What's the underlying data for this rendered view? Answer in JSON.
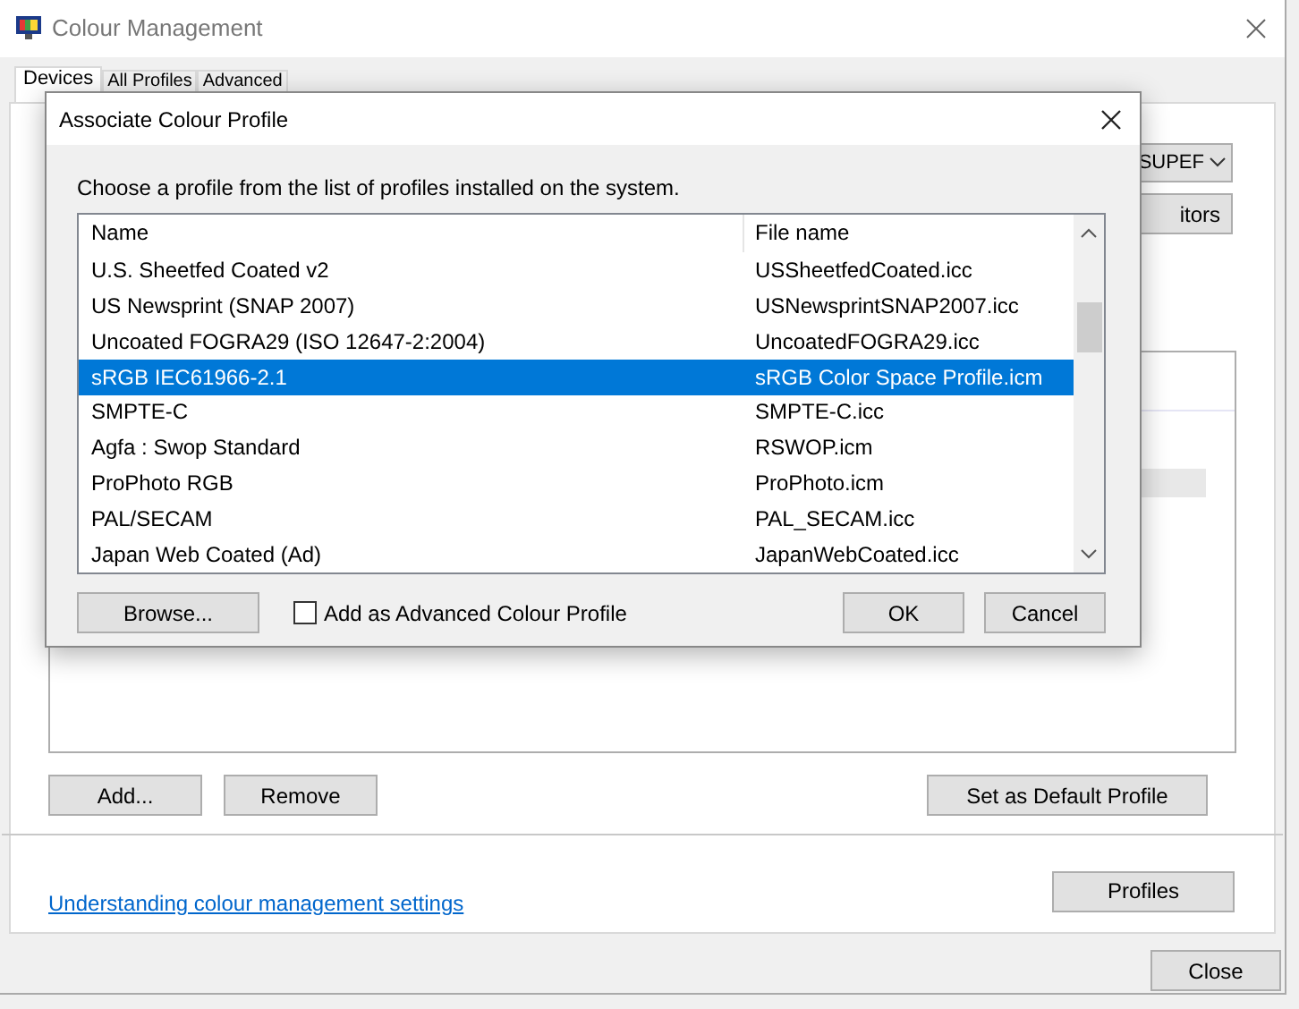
{
  "window": {
    "title": "Colour Management"
  },
  "tabs": [
    {
      "label": "Devices",
      "selected": true
    },
    {
      "label": "All Profiles",
      "selected": false
    },
    {
      "label": "Advanced",
      "selected": false
    }
  ],
  "device_dropdown": {
    "value": "SUPEF"
  },
  "monitors_button": "itors",
  "profile_buttons": [
    "Add...",
    "Remove"
  ],
  "default_button": "Set as Default Profile",
  "help_link": "Understanding colour management settings",
  "profiles_button": "Profiles",
  "close_button": "Close",
  "dialog": {
    "title": "Associate Colour Profile",
    "instruction": "Choose a profile from the list of profiles installed on the system.",
    "columns": [
      "Name",
      "File name"
    ],
    "rows": [
      {
        "name": "U.S. Sheetfed Coated v2",
        "file": "USSheetfedCoated.icc",
        "selected": false
      },
      {
        "name": "US Newsprint (SNAP 2007)",
        "file": "USNewsprintSNAP2007.icc",
        "selected": false
      },
      {
        "name": "Uncoated FOGRA29 (ISO 12647-2:2004)",
        "file": "UncoatedFOGRA29.icc",
        "selected": false
      },
      {
        "name": "sRGB IEC61966-2.1",
        "file": "sRGB Color Space Profile.icm",
        "selected": true
      },
      {
        "name": "SMPTE-C",
        "file": "SMPTE-C.icc",
        "selected": false
      },
      {
        "name": "Agfa : Swop Standard",
        "file": "RSWOP.icm",
        "selected": false
      },
      {
        "name": "ProPhoto RGB",
        "file": "ProPhoto.icm",
        "selected": false
      },
      {
        "name": "PAL/SECAM",
        "file": "PAL_SECAM.icc",
        "selected": false
      },
      {
        "name": "Japan Web Coated (Ad)",
        "file": "JapanWebCoated.icc",
        "selected": false
      }
    ],
    "browse_button": "Browse...",
    "advanced_checkbox": {
      "label": "Add as Advanced Colour Profile",
      "checked": false
    },
    "buttons": [
      "OK",
      "Cancel"
    ]
  }
}
